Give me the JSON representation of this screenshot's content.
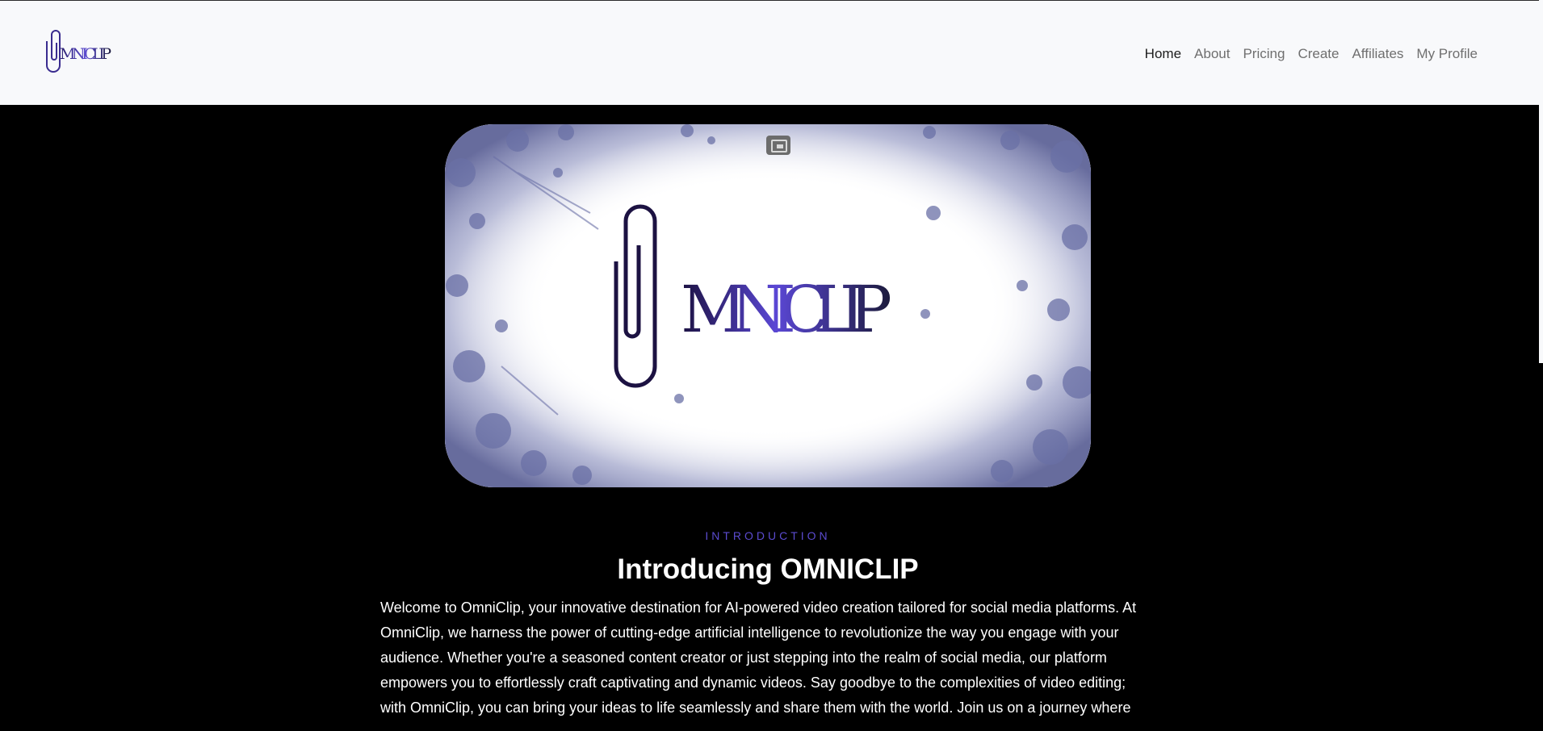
{
  "brand": {
    "logo_text": "OMNICLIP",
    "accent": "#5b4bcf",
    "dark": "#1b1a3a"
  },
  "nav": {
    "items": [
      {
        "label": "Home",
        "active": true
      },
      {
        "label": "About"
      },
      {
        "label": "Pricing"
      },
      {
        "label": "Create"
      },
      {
        "label": "Affiliates"
      },
      {
        "label": "My Profile"
      }
    ]
  },
  "video": {
    "control_icon": "picture-in-picture-icon",
    "logo_text": "OMNICLIP"
  },
  "section": {
    "eyebrow": "INTRODUCTION",
    "title": "Introducing OMNICLIP",
    "body": "Welcome to OmniClip, your innovative destination for AI-powered video creation tailored for social media platforms. At OmniClip, we harness the power of cutting-edge artificial intelligence to revolutionize the way you engage with your audience. Whether you're a seasoned content creator or just stepping into the realm of social media, our platform empowers you to effortlessly craft captivating and dynamic videos. Say goodbye to the complexities of video editing; with OmniClip, you can bring your ideas to life seamlessly and share them with the world. Join us on a journey where"
  }
}
